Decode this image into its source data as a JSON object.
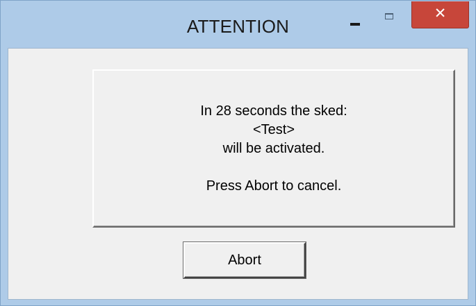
{
  "window": {
    "title": "ATTENTION",
    "controls": {
      "minimize_icon": "minimize-icon",
      "maximize_icon": "maximize-icon",
      "close_icon": "close-icon",
      "close_symbol": "✕",
      "close_color": "#c7463a"
    }
  },
  "message": {
    "lines": [
      "In 28 seconds the sked:",
      "<Test>",
      "will be activated.",
      "",
      "Press Abort to cancel."
    ]
  },
  "buttons": {
    "abort_label": "Abort"
  }
}
